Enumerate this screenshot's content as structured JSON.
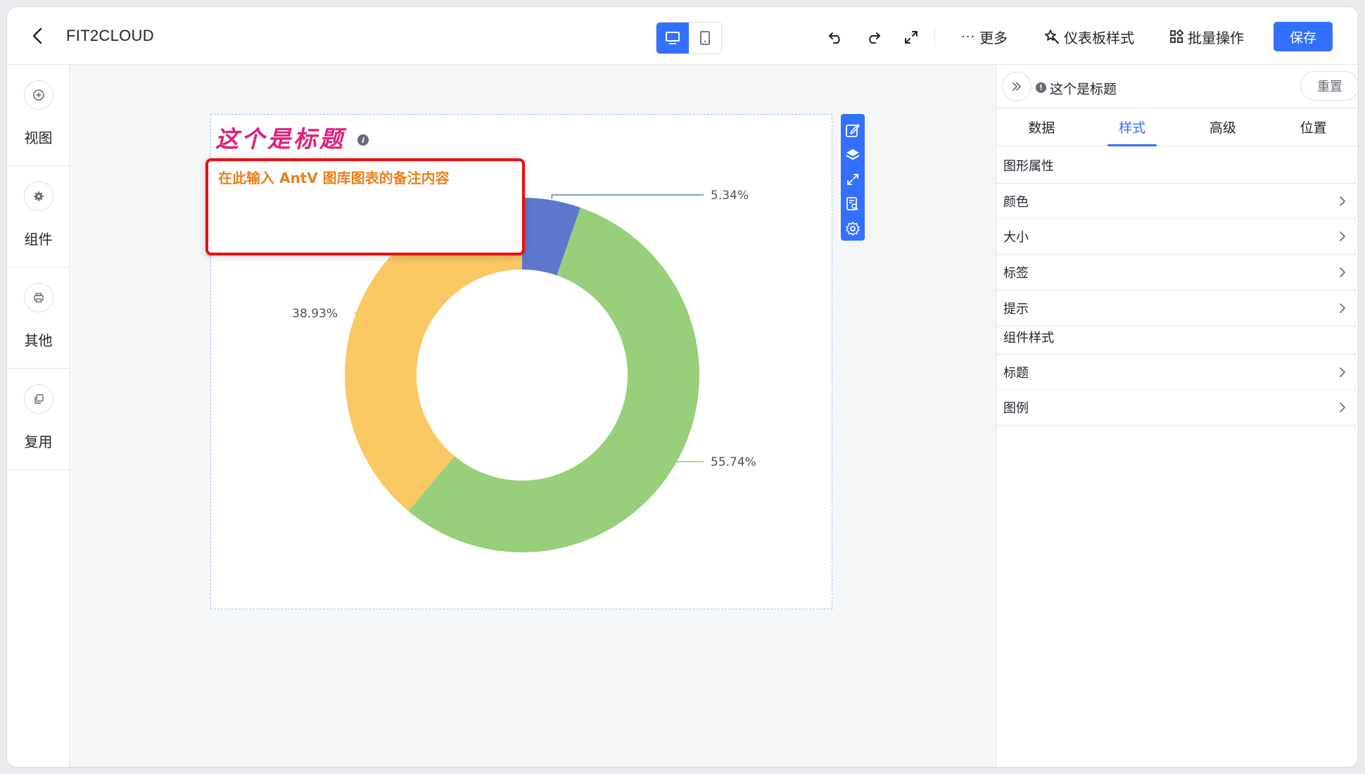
{
  "header": {
    "title": "FIT2CLOUD",
    "more_label": "更多",
    "dashboard_style_label": "仪表板样式",
    "batch_label": "批量操作",
    "save_label": "保存"
  },
  "sidebar": {
    "items": [
      {
        "label": "视图",
        "icon": "plus-circle-icon"
      },
      {
        "label": "组件",
        "icon": "gear-icon"
      },
      {
        "label": "其他",
        "icon": "printer-icon"
      },
      {
        "label": "复用",
        "icon": "copy-icon"
      }
    ]
  },
  "chart_card": {
    "title": "这个是标题",
    "note": "在此输入 AntV 图库图表的备注内容"
  },
  "chart_data": {
    "type": "pie",
    "donut": true,
    "categories": [
      "",
      "",
      ""
    ],
    "values": [
      5.34,
      55.74,
      38.93
    ],
    "labels": [
      "5.34%",
      "55.74%",
      "38.93%"
    ],
    "colors": [
      "#5b78cc",
      "#97cf7b",
      "#f9c863"
    ],
    "title": "这个是标题"
  },
  "panel": {
    "title": "这个是标题",
    "reset_label": "重置",
    "tabs": [
      {
        "label": "数据",
        "active": false
      },
      {
        "label": "样式",
        "active": true
      },
      {
        "label": "高级",
        "active": false
      },
      {
        "label": "位置",
        "active": false
      }
    ],
    "graphic_section": "图形属性",
    "graphic_items": [
      "颜色",
      "大小",
      "标签",
      "提示"
    ],
    "component_section": "组件样式",
    "component_items": [
      "标题",
      "图例"
    ]
  },
  "colors": {
    "accent": "#3370ff",
    "title_color": "#e0207a",
    "note_color": "#e8801d",
    "highlight_border": "#f00d0d"
  }
}
